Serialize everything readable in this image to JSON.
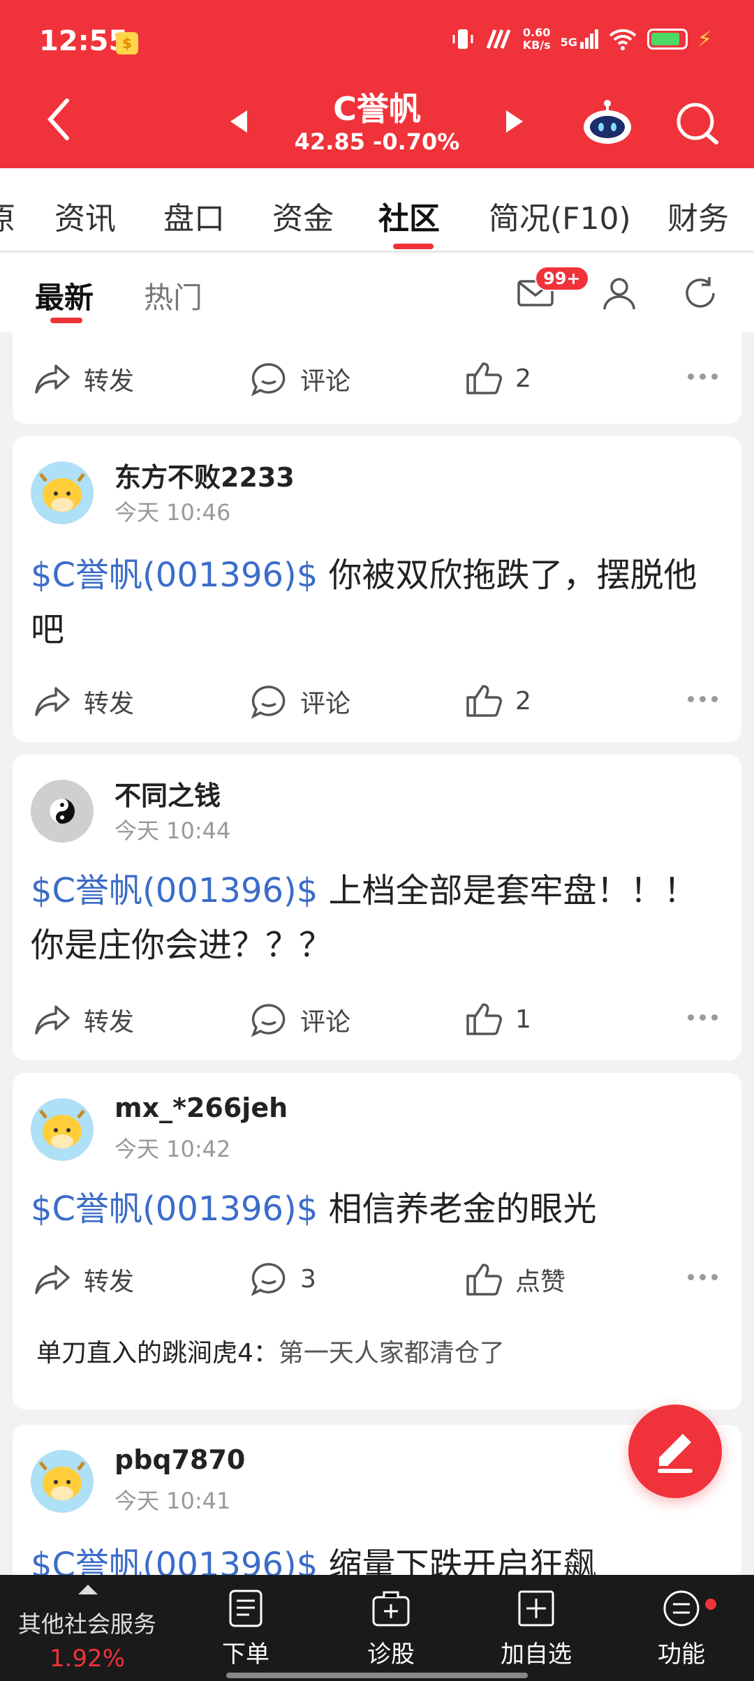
{
  "status_bar": {
    "time": "12:55",
    "net_speed_value": "0.60",
    "net_speed_unit": "KB/s",
    "network": "5G"
  },
  "header": {
    "stock_name": "C誉帆",
    "stock_price": "42.85 -0.70%"
  },
  "tabs": [
    "原",
    "资讯",
    "盘口",
    "资金",
    "社区",
    "简况(F10)",
    "财务"
  ],
  "subtabs": {
    "latest": "最新",
    "hot": "热门",
    "mail_badge": "99+"
  },
  "actions_labels": {
    "forward": "转发",
    "comment": "评论",
    "like": "点赞"
  },
  "posts": [
    {
      "like_count": "2"
    },
    {
      "author": "东方不败2233",
      "time": "今天 10:46",
      "tag": "$C誉帆(001396)$",
      "text": " 你被双欣拖跌了，摆脱他吧",
      "like_count": "2"
    },
    {
      "author": "不同之钱",
      "time": "今天 10:44",
      "tag": "$C誉帆(001396)$",
      "text": " 上档全部是套牢盘！！！你是庄你会进？？？",
      "like_count": "1"
    },
    {
      "author": "mx_*266jeh",
      "time": "今天 10:42",
      "tag": "$C誉帆(001396)$",
      "text": " 相信养老金的眼光",
      "comment_count": "3",
      "reply_author": "单刀直入的跳涧虎4：",
      "reply_text": "第一天人家都清仓了"
    },
    {
      "author": "pbq7870",
      "time": "今天 10:41",
      "tag": "$C誉帆(001396)$",
      "text": " 缩量下跌开启狂飙"
    }
  ],
  "bottom_bar": {
    "services_label": "其他社会服务",
    "services_pct": "1.92%",
    "items": [
      "下单",
      "诊股",
      "加自选",
      "功能"
    ]
  },
  "colors": {
    "brand_red": "#f0323a",
    "tag_blue": "#3b6cc9"
  }
}
